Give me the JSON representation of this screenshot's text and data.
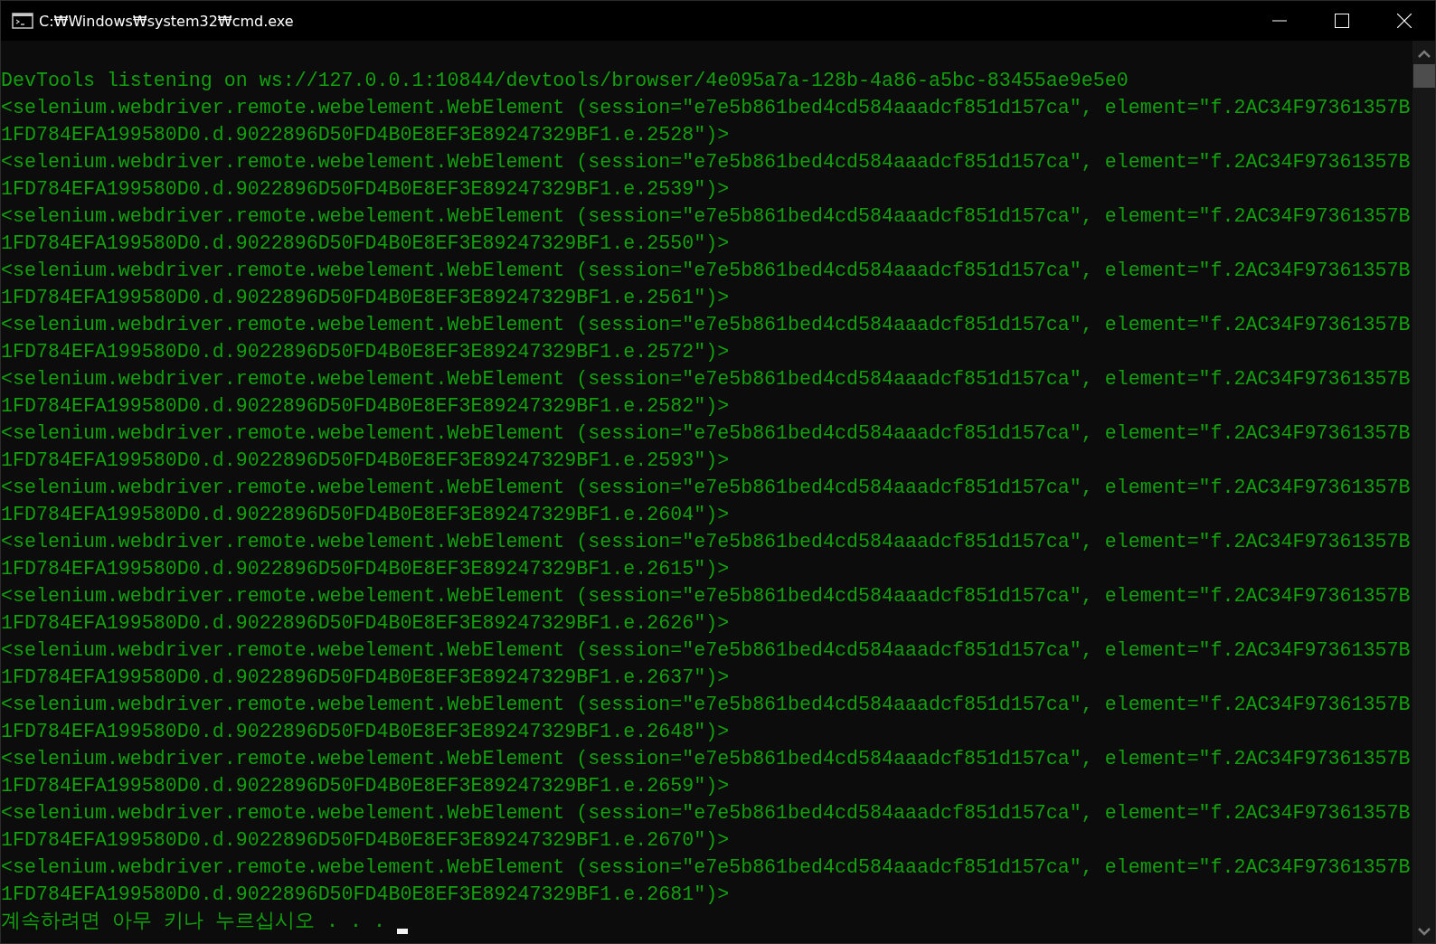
{
  "window": {
    "title": "C:₩Windows₩system32₩cmd.exe"
  },
  "console": {
    "lines": [
      "DevTools listening on ws://127.0.0.1:10844/devtools/browser/4e095a7a-128b-4a86-a5bc-83455ae9e5e0",
      "<selenium.webdriver.remote.webelement.WebElement (session=\"e7e5b861bed4cd584aaadcf851d157ca\", element=\"f.2AC34F97361357B",
      "1FD784EFA199580D0.d.9022896D50FD4B0E8EF3E89247329BF1.e.2528\")>",
      "<selenium.webdriver.remote.webelement.WebElement (session=\"e7e5b861bed4cd584aaadcf851d157ca\", element=\"f.2AC34F97361357B",
      "1FD784EFA199580D0.d.9022896D50FD4B0E8EF3E89247329BF1.e.2539\")>",
      "<selenium.webdriver.remote.webelement.WebElement (session=\"e7e5b861bed4cd584aaadcf851d157ca\", element=\"f.2AC34F97361357B",
      "1FD784EFA199580D0.d.9022896D50FD4B0E8EF3E89247329BF1.e.2550\")>",
      "<selenium.webdriver.remote.webelement.WebElement (session=\"e7e5b861bed4cd584aaadcf851d157ca\", element=\"f.2AC34F97361357B",
      "1FD784EFA199580D0.d.9022896D50FD4B0E8EF3E89247329BF1.e.2561\")>",
      "<selenium.webdriver.remote.webelement.WebElement (session=\"e7e5b861bed4cd584aaadcf851d157ca\", element=\"f.2AC34F97361357B",
      "1FD784EFA199580D0.d.9022896D50FD4B0E8EF3E89247329BF1.e.2572\")>",
      "<selenium.webdriver.remote.webelement.WebElement (session=\"e7e5b861bed4cd584aaadcf851d157ca\", element=\"f.2AC34F97361357B",
      "1FD784EFA199580D0.d.9022896D50FD4B0E8EF3E89247329BF1.e.2582\")>",
      "<selenium.webdriver.remote.webelement.WebElement (session=\"e7e5b861bed4cd584aaadcf851d157ca\", element=\"f.2AC34F97361357B",
      "1FD784EFA199580D0.d.9022896D50FD4B0E8EF3E89247329BF1.e.2593\")>",
      "<selenium.webdriver.remote.webelement.WebElement (session=\"e7e5b861bed4cd584aaadcf851d157ca\", element=\"f.2AC34F97361357B",
      "1FD784EFA199580D0.d.9022896D50FD4B0E8EF3E89247329BF1.e.2604\")>",
      "<selenium.webdriver.remote.webelement.WebElement (session=\"e7e5b861bed4cd584aaadcf851d157ca\", element=\"f.2AC34F97361357B",
      "1FD784EFA199580D0.d.9022896D50FD4B0E8EF3E89247329BF1.e.2615\")>",
      "<selenium.webdriver.remote.webelement.WebElement (session=\"e7e5b861bed4cd584aaadcf851d157ca\", element=\"f.2AC34F97361357B",
      "1FD784EFA199580D0.d.9022896D50FD4B0E8EF3E89247329BF1.e.2626\")>",
      "<selenium.webdriver.remote.webelement.WebElement (session=\"e7e5b861bed4cd584aaadcf851d157ca\", element=\"f.2AC34F97361357B",
      "1FD784EFA199580D0.d.9022896D50FD4B0E8EF3E89247329BF1.e.2637\")>",
      "<selenium.webdriver.remote.webelement.WebElement (session=\"e7e5b861bed4cd584aaadcf851d157ca\", element=\"f.2AC34F97361357B",
      "1FD784EFA199580D0.d.9022896D50FD4B0E8EF3E89247329BF1.e.2648\")>",
      "<selenium.webdriver.remote.webelement.WebElement (session=\"e7e5b861bed4cd584aaadcf851d157ca\", element=\"f.2AC34F97361357B",
      "1FD784EFA199580D0.d.9022896D50FD4B0E8EF3E89247329BF1.e.2659\")>",
      "<selenium.webdriver.remote.webelement.WebElement (session=\"e7e5b861bed4cd584aaadcf851d157ca\", element=\"f.2AC34F97361357B",
      "1FD784EFA199580D0.d.9022896D50FD4B0E8EF3E89247329BF1.e.2670\")>",
      "<selenium.webdriver.remote.webelement.WebElement (session=\"e7e5b861bed4cd584aaadcf851d157ca\", element=\"f.2AC34F97361357B",
      "1FD784EFA199580D0.d.9022896D50FD4B0E8EF3E89247329BF1.e.2681\")>"
    ],
    "prompt": "계속하려면 아무 키나 누르십시오 . . ."
  }
}
